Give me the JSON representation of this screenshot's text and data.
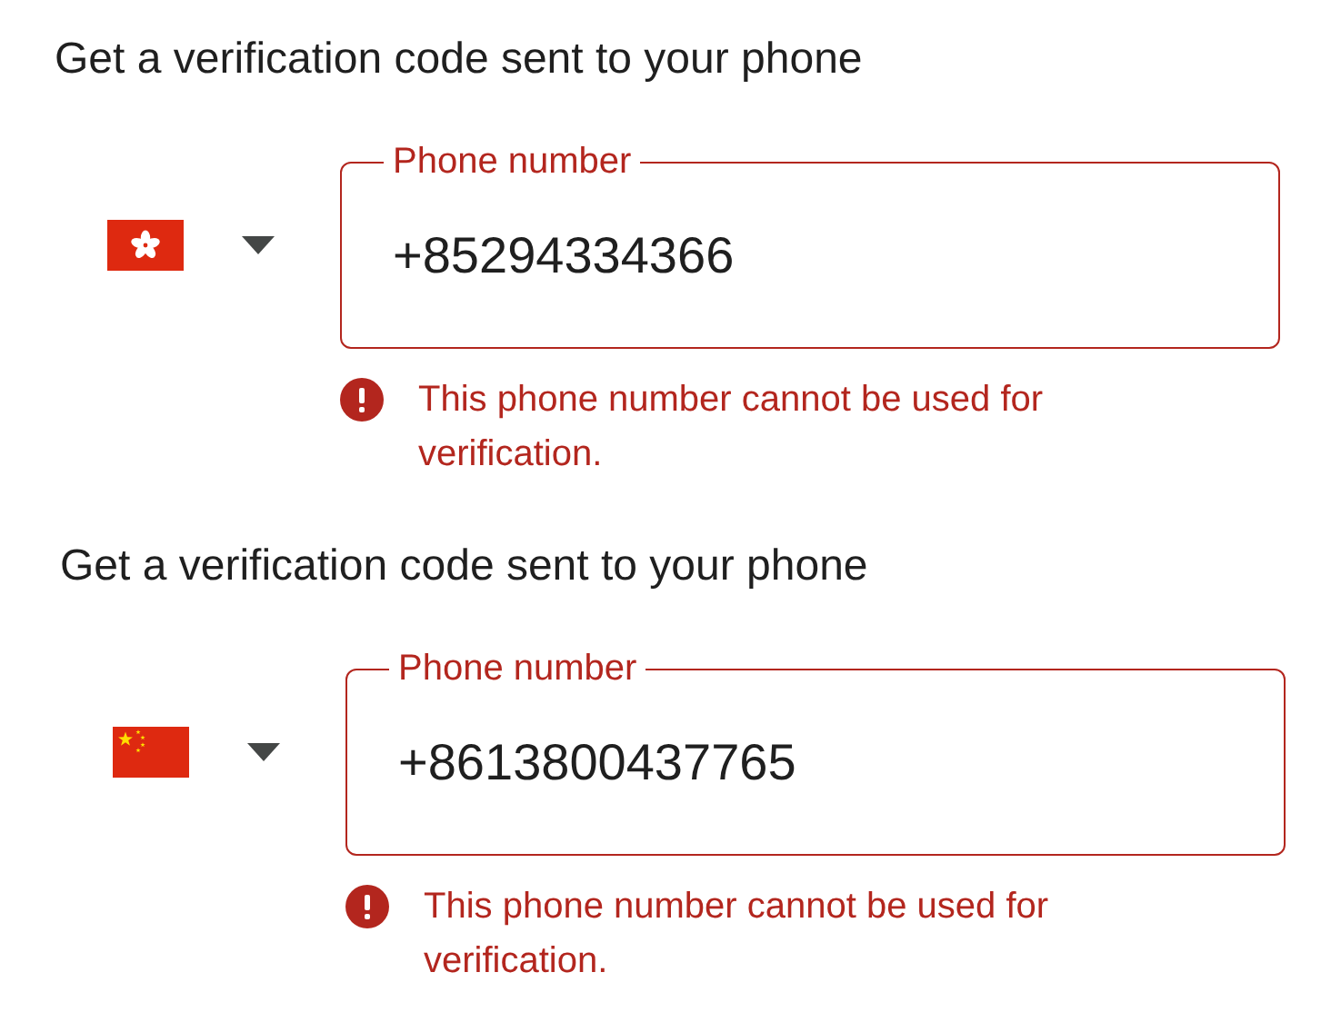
{
  "sections": [
    {
      "heading": "Get a verification code sent to your phone",
      "kind": "hk",
      "field": {
        "label": "Phone number",
        "value": "+85294334366",
        "invalid": true
      },
      "error": "This phone number cannot be used for verification."
    },
    {
      "heading": "Get a verification code sent to your phone",
      "kind": "cn",
      "field": {
        "label": "Phone number",
        "value": "+8613800437765",
        "invalid": true
      },
      "error": "This phone number cannot be used for verification."
    }
  ]
}
